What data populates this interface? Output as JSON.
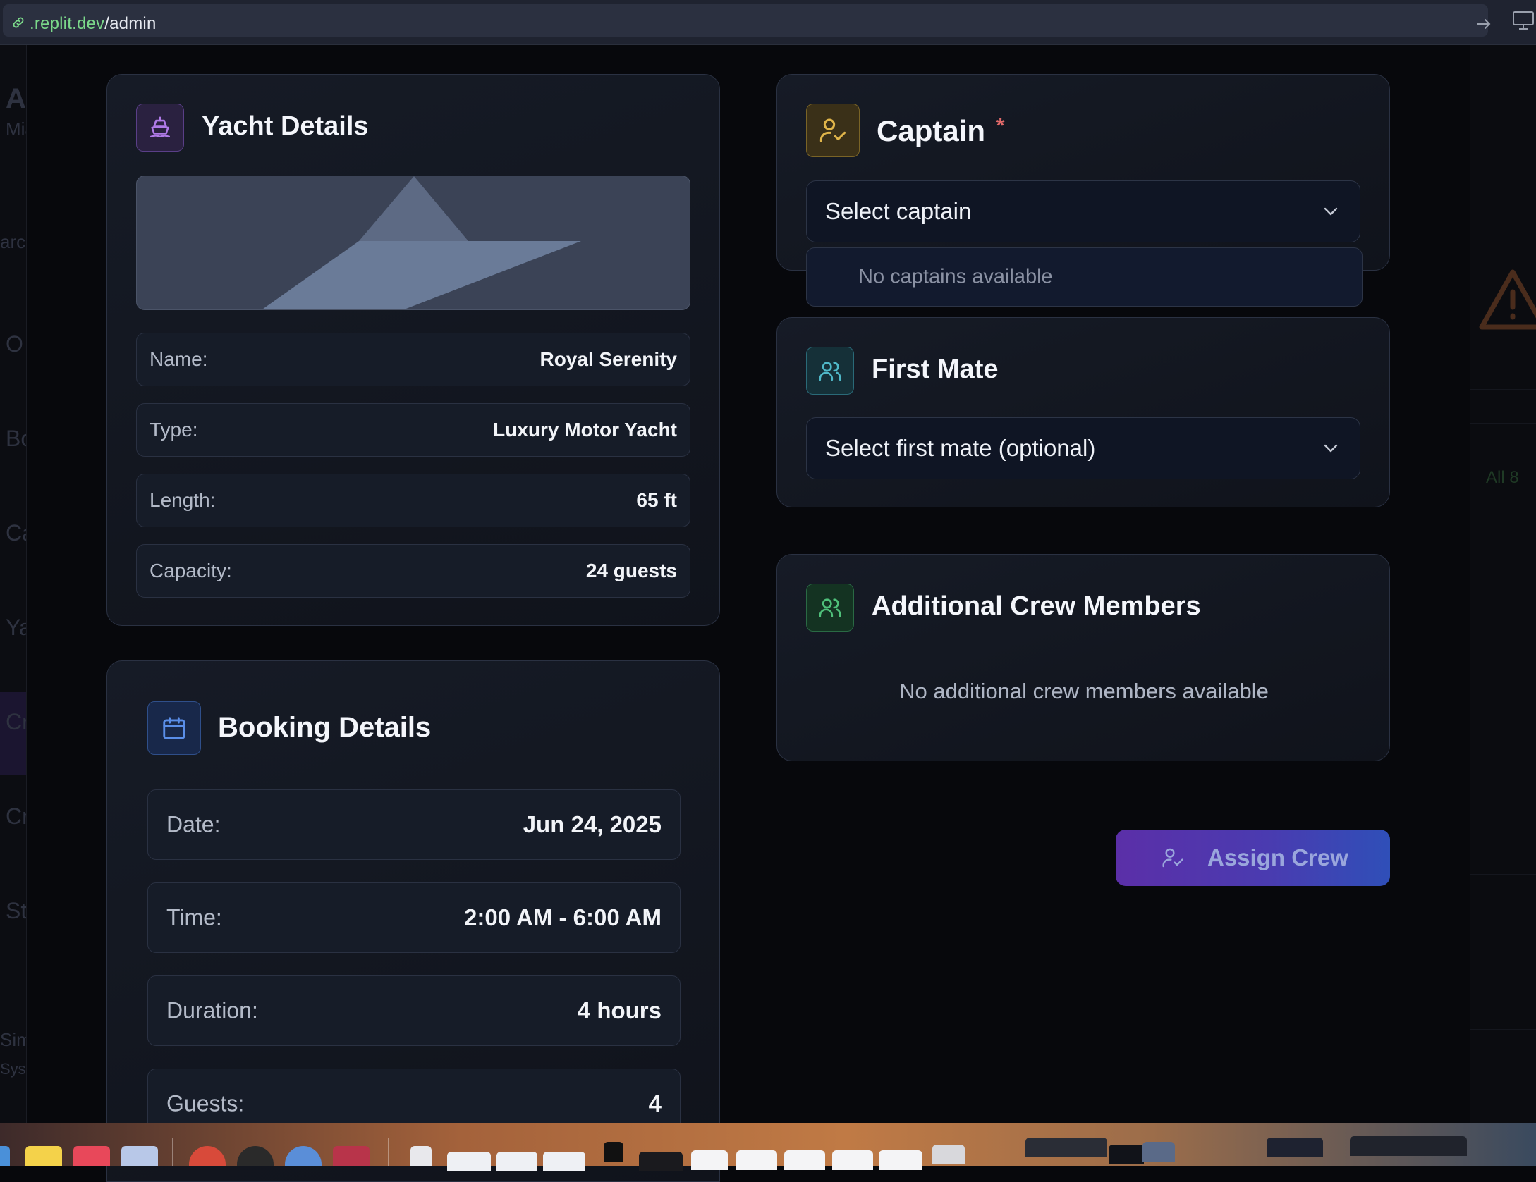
{
  "browser": {
    "url_domain": ".replit.dev",
    "url_path": "/admin"
  },
  "background_letters": [
    "Ac",
    "Mia",
    "arch",
    "O",
    "Bo",
    "Ca",
    "Ya",
    "Cr",
    "Cr",
    "St",
    "Sim",
    "Sys"
  ],
  "background_right": {
    "badge": "All 8"
  },
  "yacht_details": {
    "title": "Yacht Details",
    "icon": "ship-icon",
    "fields": [
      {
        "label": "Name:",
        "value": "Royal Serenity"
      },
      {
        "label": "Type:",
        "value": "Luxury Motor Yacht"
      },
      {
        "label": "Length:",
        "value": "65 ft"
      },
      {
        "label": "Capacity:",
        "value": "24 guests"
      }
    ]
  },
  "booking_details": {
    "title": "Booking Details",
    "icon": "calendar-icon",
    "fields": [
      {
        "label": "Date:",
        "value": "Jun 24, 2025"
      },
      {
        "label": "Time:",
        "value": "2:00 AM - 6:00 AM"
      },
      {
        "label": "Duration:",
        "value": "4 hours"
      },
      {
        "label": "Guests:",
        "value": "4"
      }
    ]
  },
  "captain": {
    "title": "Captain",
    "required_mark": "*",
    "icon": "user-check-icon",
    "select_value": "Select captain",
    "dropdown_empty": "No captains available"
  },
  "first_mate": {
    "title": "First Mate",
    "icon": "users-icon",
    "select_value": "Select first mate (optional)"
  },
  "additional_crew": {
    "title": "Additional Crew Members",
    "icon": "users-icon",
    "empty_message": "No additional crew members available"
  },
  "assign_button": {
    "label": "Assign Crew",
    "icon": "user-check-icon"
  },
  "colors": {
    "captain_accent": "#e0b54a",
    "first_mate_accent": "#4fb8c8",
    "crew_accent": "#4fc07a",
    "yacht_accent": "#b07ae8",
    "booking_accent": "#5a8ee8",
    "required": "#e26a6a",
    "button_gradient_start": "#5b2fa8",
    "button_gradient_end": "#2f4fb8"
  }
}
